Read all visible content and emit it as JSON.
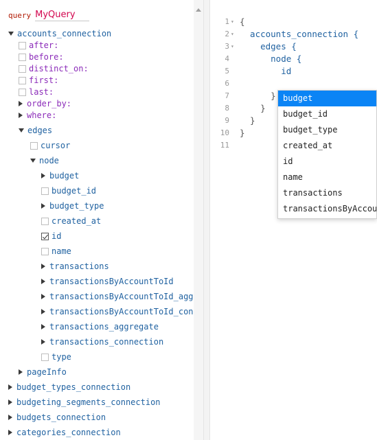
{
  "explorer": {
    "keyword": "query",
    "query_name": "MyQuery",
    "rows": [
      {
        "label": "accounts_connection",
        "kind": "expanded",
        "indent": 0,
        "cls": "fname"
      },
      {
        "label": "after:",
        "kind": "checkbox",
        "indent": 1,
        "cls": "arg"
      },
      {
        "label": "before:",
        "kind": "checkbox",
        "indent": 1,
        "cls": "arg"
      },
      {
        "label": "distinct_on:",
        "kind": "checkbox",
        "indent": 1,
        "cls": "arg"
      },
      {
        "label": "first:",
        "kind": "checkbox",
        "indent": 1,
        "cls": "arg"
      },
      {
        "label": "last:",
        "kind": "checkbox",
        "indent": 1,
        "cls": "arg"
      },
      {
        "label": "order_by:",
        "kind": "collapsed",
        "indent": 1,
        "cls": "arg"
      },
      {
        "label": "where:",
        "kind": "collapsed",
        "indent": 1,
        "cls": "arg"
      },
      {
        "label": "edges",
        "kind": "expanded",
        "indent": 1,
        "cls": "fname"
      },
      {
        "label": "cursor",
        "kind": "checkbox",
        "indent": 2,
        "cls": "fname"
      },
      {
        "label": "node",
        "kind": "expanded",
        "indent": 2,
        "cls": "fname"
      },
      {
        "label": "budget",
        "kind": "collapsed",
        "indent": 3,
        "cls": "fname"
      },
      {
        "label": "budget_id",
        "kind": "checkbox",
        "indent": 3,
        "cls": "fname"
      },
      {
        "label": "budget_type",
        "kind": "collapsed",
        "indent": 3,
        "cls": "fname"
      },
      {
        "label": "created_at",
        "kind": "checkbox",
        "indent": 3,
        "cls": "fname"
      },
      {
        "label": "id",
        "kind": "checked",
        "indent": 3,
        "cls": "fname"
      },
      {
        "label": "name",
        "kind": "checkbox",
        "indent": 3,
        "cls": "fname"
      },
      {
        "label": "transactions",
        "kind": "collapsed",
        "indent": 3,
        "cls": "fname"
      },
      {
        "label": "transactionsByAccountToId",
        "kind": "collapsed",
        "indent": 3,
        "cls": "fname"
      },
      {
        "label": "transactionsByAccountToId_aggregate",
        "kind": "collapsed",
        "indent": 3,
        "cls": "fname"
      },
      {
        "label": "transactionsByAccountToId_connection",
        "kind": "collapsed",
        "indent": 3,
        "cls": "fname"
      },
      {
        "label": "transactions_aggregate",
        "kind": "collapsed",
        "indent": 3,
        "cls": "fname"
      },
      {
        "label": "transactions_connection",
        "kind": "collapsed",
        "indent": 3,
        "cls": "fname"
      },
      {
        "label": "type",
        "kind": "checkbox",
        "indent": 3,
        "cls": "fname"
      },
      {
        "label": "pageInfo",
        "kind": "collapsed",
        "indent": 1,
        "cls": "fname"
      },
      {
        "label": "budget_types_connection",
        "kind": "collapsed",
        "indent": 0,
        "cls": "fname"
      },
      {
        "label": "budgeting_segments_connection",
        "kind": "collapsed",
        "indent": 0,
        "cls": "fname"
      },
      {
        "label": "budgets_connection",
        "kind": "collapsed",
        "indent": 0,
        "cls": "fname"
      },
      {
        "label": "categories_connection",
        "kind": "collapsed",
        "indent": 0,
        "cls": "fname"
      }
    ]
  },
  "editor": {
    "lines": [
      {
        "n": "1",
        "fold": "▾",
        "text": "{",
        "cls": "p"
      },
      {
        "n": "2",
        "fold": "▾",
        "text": "  accounts_connection {",
        "cls": "f"
      },
      {
        "n": "3",
        "fold": "▾",
        "text": "    edges {",
        "cls": "f"
      },
      {
        "n": "4",
        "fold": "",
        "text": "      node {",
        "cls": "f"
      },
      {
        "n": "5",
        "fold": "",
        "text": "        id",
        "cls": "f"
      },
      {
        "n": "6",
        "fold": "",
        "text": "",
        "cls": "p"
      },
      {
        "n": "7",
        "fold": "",
        "text": "      }",
        "cls": "p"
      },
      {
        "n": "8",
        "fold": "",
        "text": "    }",
        "cls": "p"
      },
      {
        "n": "9",
        "fold": "",
        "text": "  }",
        "cls": "p"
      },
      {
        "n": "10",
        "fold": "",
        "text": "}",
        "cls": "p"
      },
      {
        "n": "11",
        "fold": "",
        "text": "",
        "cls": "p"
      }
    ]
  },
  "autocomplete": {
    "selected_index": 0,
    "items": [
      "budget",
      "budget_id",
      "budget_type",
      "created_at",
      "id",
      "name",
      "transactions",
      "transactionsByAccountToId"
    ]
  },
  "colors": {
    "accent": "#0b84f5",
    "keyword": "#b11a04",
    "query_name": "#d2054e",
    "argument": "#8b2bb9",
    "field": "#1f61a0"
  },
  "icons": {
    "expanded": "caret-down-icon",
    "collapsed": "caret-right-icon",
    "checkbox": "checkbox-icon",
    "checked": "checkbox-checked-icon"
  }
}
